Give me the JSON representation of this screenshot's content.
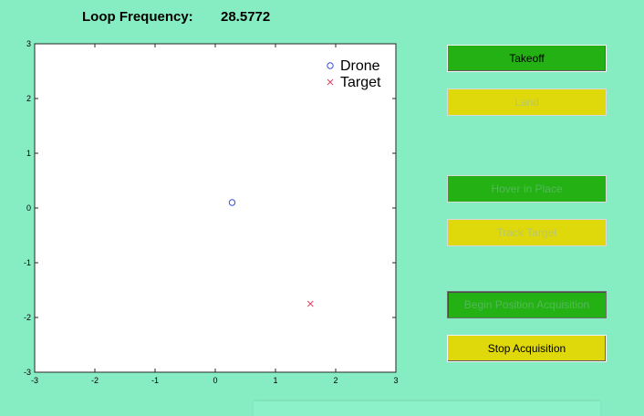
{
  "status": {
    "label": "Loop Frequency:",
    "value": "28.5772"
  },
  "buttons": [
    {
      "id": "takeoff",
      "label": "Takeoff",
      "color": "#24b113",
      "enabled": true
    },
    {
      "id": "land",
      "label": "Land",
      "color": "#dfd80b",
      "enabled": false
    },
    {
      "id": "hover",
      "label": "Hover in Place",
      "color": "#24b113",
      "enabled": false
    },
    {
      "id": "track",
      "label": "Track Target",
      "color": "#dfd80b",
      "enabled": false
    },
    {
      "id": "begin",
      "label": "Begin Position Acquisition",
      "color": "#24b113",
      "enabled": false
    },
    {
      "id": "stop",
      "label": "Stop Acquisition",
      "color": "#dfd80b",
      "enabled": true
    }
  ],
  "chart_data": {
    "type": "scatter",
    "xlim": [
      -3,
      3
    ],
    "ylim": [
      -3,
      3
    ],
    "xticks": [
      -3,
      -2,
      -1,
      0,
      1,
      2,
      3
    ],
    "yticks": [
      -3,
      -2,
      -1,
      0,
      1,
      2,
      3
    ],
    "grid": false,
    "legend_position": "top-right",
    "series": [
      {
        "name": "Drone",
        "marker": "circle",
        "color": "#3a50d8",
        "points": [
          [
            0.28,
            0.1
          ]
        ]
      },
      {
        "name": "Target",
        "marker": "x",
        "color": "#e0405e",
        "points": [
          [
            1.58,
            -1.75
          ]
        ]
      }
    ]
  }
}
